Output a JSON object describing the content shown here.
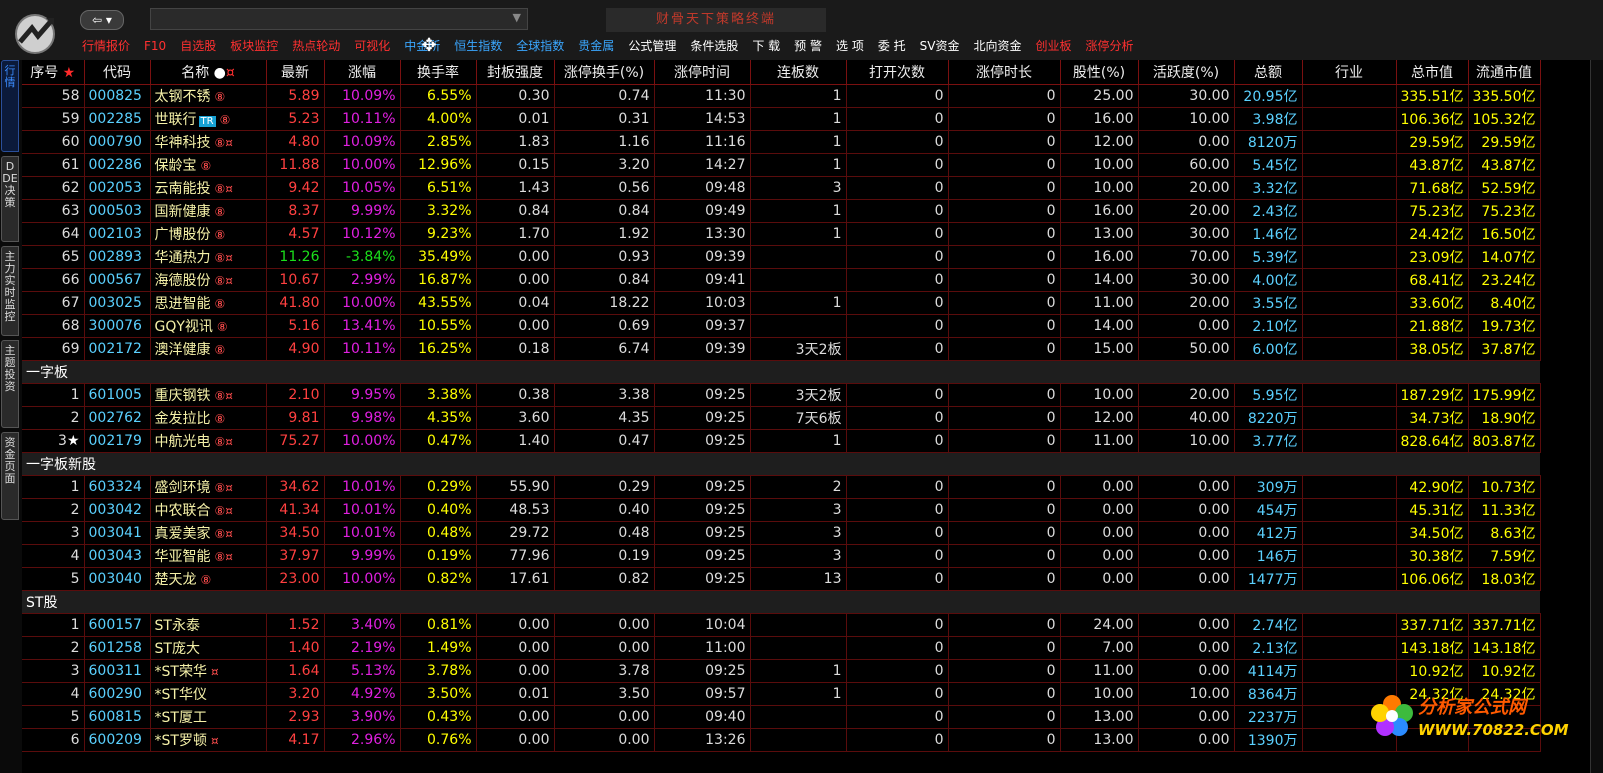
{
  "topbar": {
    "app_title": "财骨天下策略终端",
    "menu": [
      {
        "label": "行情报价",
        "color": "#ff3030"
      },
      {
        "label": "F10",
        "color": "#ff3030"
      },
      {
        "label": "自选股",
        "color": "#ff3030"
      },
      {
        "label": "板块监控",
        "color": "#ff3030"
      },
      {
        "label": "热点轮动",
        "color": "#ff3030"
      },
      {
        "label": "可视化",
        "color": "#ff3030"
      },
      {
        "label": "中金所",
        "color": "#3aa7ff"
      },
      {
        "label": "恒生指数",
        "color": "#3aa7ff"
      },
      {
        "label": "全球指数",
        "color": "#3aa7ff"
      },
      {
        "label": "贵金属",
        "color": "#3aa7ff"
      },
      {
        "label": "公式管理",
        "color": "#ffffff"
      },
      {
        "label": "条件选股",
        "color": "#ffffff"
      },
      {
        "label": "下  载",
        "color": "#ffffff"
      },
      {
        "label": "预  警",
        "color": "#ffffff"
      },
      {
        "label": "选  项",
        "color": "#ffffff"
      },
      {
        "label": "委  托",
        "color": "#ffffff"
      },
      {
        "label": "SV资金",
        "color": "#ffffff"
      },
      {
        "label": "北向资金",
        "color": "#ffffff"
      },
      {
        "label": "创业板",
        "color": "#ff3030"
      },
      {
        "label": "涨停分析",
        "color": "#ff3030"
      }
    ]
  },
  "left_tabs": [
    "行情",
    "DDE决策",
    "主力实时监控",
    "主题投资",
    "资金页面"
  ],
  "table": {
    "headers": [
      "序号",
      "代码",
      "名称",
      "最新",
      "涨幅",
      "换手率",
      "封板强度",
      "涨停换手(%)",
      "涨停时间",
      "连板数",
      "打开次数",
      "涨停时长",
      "股性(%)",
      "活跃度(%)",
      "总额",
      "行业",
      "总市值",
      "流通市值"
    ],
    "rows": [
      {
        "type": "data",
        "idx": "58",
        "code": "000825",
        "name": "太钢不锈",
        "marks": "⑧",
        "price": "5.89",
        "chg": "10.09%",
        "turn": "6.55%",
        "seal": "0.30",
        "ztturn": "0.74",
        "zttime": "11:30",
        "lianban": "1",
        "opens": "0",
        "ztlen": "0",
        "gx": "25.00",
        "active": "30.00",
        "amt": "20.95亿",
        "ind": "",
        "cap": "335.51亿",
        "fcap": "335.50亿"
      },
      {
        "type": "data",
        "idx": "59",
        "code": "002285",
        "name": "世联行",
        "tr": "TR",
        "marks": "⑧",
        "price": "5.23",
        "chg": "10.11%",
        "turn": "4.00%",
        "seal": "0.01",
        "ztturn": "0.31",
        "zttime": "14:53",
        "lianban": "1",
        "opens": "0",
        "ztlen": "0",
        "gx": "16.00",
        "active": "10.00",
        "amt": "3.98亿",
        "ind": "",
        "cap": "106.36亿",
        "fcap": "105.32亿"
      },
      {
        "type": "data",
        "idx": "60",
        "code": "000790",
        "name": "华神科技",
        "marks": "⑧¤",
        "price": "4.80",
        "chg": "10.09%",
        "turn": "2.85%",
        "seal": "1.83",
        "ztturn": "1.16",
        "zttime": "11:16",
        "lianban": "1",
        "opens": "0",
        "ztlen": "0",
        "gx": "12.00",
        "active": "0.00",
        "amt": "8120万",
        "ind": "",
        "cap": "29.59亿",
        "fcap": "29.59亿"
      },
      {
        "type": "data",
        "idx": "61",
        "code": "002286",
        "name": "保龄宝",
        "marks": "⑧",
        "price": "11.88",
        "chg": "10.00%",
        "turn": "12.96%",
        "seal": "0.15",
        "ztturn": "3.20",
        "zttime": "14:27",
        "lianban": "1",
        "opens": "0",
        "ztlen": "0",
        "gx": "10.00",
        "active": "60.00",
        "amt": "5.45亿",
        "ind": "",
        "cap": "43.87亿",
        "fcap": "43.87亿"
      },
      {
        "type": "data",
        "idx": "62",
        "code": "002053",
        "name": "云南能投",
        "marks": "⑧¤",
        "price": "9.42",
        "chg": "10.05%",
        "turn": "6.51%",
        "seal": "1.43",
        "ztturn": "0.56",
        "zttime": "09:48",
        "lianban": "3",
        "opens": "0",
        "ztlen": "0",
        "gx": "10.00",
        "active": "20.00",
        "amt": "3.32亿",
        "ind": "",
        "cap": "71.68亿",
        "fcap": "52.59亿"
      },
      {
        "type": "data",
        "idx": "63",
        "code": "000503",
        "name": "国新健康",
        "marks": "⑧",
        "price": "8.37",
        "chg": "9.99%",
        "turn": "3.32%",
        "seal": "0.84",
        "ztturn": "0.84",
        "zttime": "09:49",
        "lianban": "1",
        "opens": "0",
        "ztlen": "0",
        "gx": "16.00",
        "active": "20.00",
        "amt": "2.43亿",
        "ind": "",
        "cap": "75.23亿",
        "fcap": "75.23亿"
      },
      {
        "type": "data",
        "idx": "64",
        "code": "002103",
        "name": "广博股份",
        "marks": "⑧",
        "price": "4.57",
        "chg": "10.12%",
        "turn": "9.23%",
        "seal": "1.70",
        "ztturn": "1.92",
        "zttime": "13:30",
        "lianban": "1",
        "opens": "0",
        "ztlen": "0",
        "gx": "13.00",
        "active": "30.00",
        "amt": "1.46亿",
        "ind": "",
        "cap": "24.42亿",
        "fcap": "16.50亿"
      },
      {
        "type": "data",
        "idx": "65",
        "code": "002893",
        "name": "华通热力",
        "marks": "⑧¤",
        "price": "11.26",
        "chg": "-3.84%",
        "neg": true,
        "turn": "35.49%",
        "seal": "0.00",
        "ztturn": "0.93",
        "zttime": "09:39",
        "lianban": "",
        "opens": "0",
        "ztlen": "0",
        "gx": "16.00",
        "active": "70.00",
        "amt": "5.39亿",
        "ind": "",
        "cap": "23.09亿",
        "fcap": "14.07亿"
      },
      {
        "type": "data",
        "idx": "66",
        "code": "000567",
        "name": "海德股份",
        "marks": "⑧¤",
        "price": "10.67",
        "chg": "2.99%",
        "turn": "16.87%",
        "seal": "0.00",
        "ztturn": "0.84",
        "zttime": "09:41",
        "lianban": "",
        "opens": "0",
        "ztlen": "0",
        "gx": "14.00",
        "active": "30.00",
        "amt": "4.00亿",
        "ind": "",
        "cap": "68.41亿",
        "fcap": "23.24亿"
      },
      {
        "type": "data",
        "idx": "67",
        "code": "003025",
        "name": "思进智能",
        "marks": "⑧",
        "price": "41.80",
        "chg": "10.00%",
        "turn": "43.55%",
        "seal": "0.04",
        "ztturn": "18.22",
        "zttime": "10:03",
        "lianban": "1",
        "opens": "0",
        "ztlen": "0",
        "gx": "11.00",
        "active": "20.00",
        "amt": "3.55亿",
        "ind": "",
        "cap": "33.60亿",
        "fcap": "8.40亿"
      },
      {
        "type": "data",
        "idx": "68",
        "code": "300076",
        "name": "GQY视讯",
        "marks": "⑧",
        "price": "5.16",
        "chg": "13.41%",
        "turn": "10.55%",
        "seal": "0.00",
        "ztturn": "0.69",
        "zttime": "09:37",
        "lianban": "",
        "opens": "0",
        "ztlen": "0",
        "gx": "14.00",
        "active": "0.00",
        "amt": "2.10亿",
        "ind": "",
        "cap": "21.88亿",
        "fcap": "19.73亿"
      },
      {
        "type": "data",
        "idx": "69",
        "code": "002172",
        "name": "澳洋健康",
        "marks": "⑧",
        "price": "4.90",
        "chg": "10.11%",
        "turn": "16.25%",
        "seal": "0.18",
        "ztturn": "6.74",
        "zttime": "09:39",
        "lianban": "3天2板",
        "opens": "0",
        "ztlen": "0",
        "gx": "15.00",
        "active": "50.00",
        "amt": "6.00亿",
        "ind": "",
        "cap": "38.05亿",
        "fcap": "37.87亿"
      },
      {
        "type": "sec",
        "label": "一字板"
      },
      {
        "type": "data",
        "idx": "1",
        "code": "601005",
        "name": "重庆钢铁",
        "marks": "⑧¤",
        "price": "2.10",
        "chg": "9.95%",
        "turn": "3.38%",
        "seal": "0.38",
        "ztturn": "3.38",
        "zttime": "09:25",
        "lianban": "3天2板",
        "opens": "0",
        "ztlen": "0",
        "gx": "10.00",
        "active": "20.00",
        "amt": "5.95亿",
        "ind": "",
        "cap": "187.29亿",
        "fcap": "175.99亿"
      },
      {
        "type": "data",
        "idx": "2",
        "code": "002762",
        "name": "金发拉比",
        "marks": "⑧",
        "price": "9.81",
        "chg": "9.98%",
        "turn": "4.35%",
        "seal": "3.60",
        "ztturn": "4.35",
        "zttime": "09:25",
        "lianban": "7天6板",
        "opens": "0",
        "ztlen": "0",
        "gx": "12.00",
        "active": "40.00",
        "amt": "8220万",
        "ind": "",
        "cap": "34.73亿",
        "fcap": "18.90亿"
      },
      {
        "type": "data",
        "idx": "3",
        "star": "★",
        "code": "002179",
        "name": "中航光电",
        "marks": "⑧¤",
        "price": "75.27",
        "chg": "10.00%",
        "turn": "0.47%",
        "seal": "1.40",
        "ztturn": "0.47",
        "zttime": "09:25",
        "lianban": "1",
        "opens": "0",
        "ztlen": "0",
        "gx": "11.00",
        "active": "10.00",
        "amt": "3.77亿",
        "ind": "",
        "cap": "828.64亿",
        "fcap": "803.87亿"
      },
      {
        "type": "sec",
        "label": "一字板新股"
      },
      {
        "type": "data",
        "idx": "1",
        "code": "603324",
        "name": "盛剑环境",
        "marks": "⑧¤",
        "price": "34.62",
        "chg": "10.01%",
        "turn": "0.29%",
        "seal": "55.90",
        "ztturn": "0.29",
        "zttime": "09:25",
        "lianban": "2",
        "opens": "0",
        "ztlen": "0",
        "gx": "0.00",
        "active": "0.00",
        "amt": "309万",
        "ind": "",
        "cap": "42.90亿",
        "fcap": "10.73亿"
      },
      {
        "type": "data",
        "idx": "2",
        "code": "003042",
        "name": "中农联合",
        "marks": "⑧¤",
        "price": "41.34",
        "chg": "10.01%",
        "turn": "0.40%",
        "seal": "48.53",
        "ztturn": "0.40",
        "zttime": "09:25",
        "lianban": "3",
        "opens": "0",
        "ztlen": "0",
        "gx": "0.00",
        "active": "0.00",
        "amt": "454万",
        "ind": "",
        "cap": "45.31亿",
        "fcap": "11.33亿"
      },
      {
        "type": "data",
        "idx": "3",
        "code": "003041",
        "name": "真爱美家",
        "marks": "⑧¤",
        "price": "34.50",
        "chg": "10.01%",
        "turn": "0.48%",
        "seal": "29.72",
        "ztturn": "0.48",
        "zttime": "09:25",
        "lianban": "3",
        "opens": "0",
        "ztlen": "0",
        "gx": "0.00",
        "active": "0.00",
        "amt": "412万",
        "ind": "",
        "cap": "34.50亿",
        "fcap": "8.63亿"
      },
      {
        "type": "data",
        "idx": "4",
        "code": "003043",
        "name": "华亚智能",
        "marks": "⑧¤",
        "price": "37.97",
        "chg": "9.99%",
        "turn": "0.19%",
        "seal": "77.96",
        "ztturn": "0.19",
        "zttime": "09:25",
        "lianban": "3",
        "opens": "0",
        "ztlen": "0",
        "gx": "0.00",
        "active": "0.00",
        "amt": "146万",
        "ind": "",
        "cap": "30.38亿",
        "fcap": "7.59亿"
      },
      {
        "type": "data",
        "idx": "5",
        "code": "003040",
        "name": "楚天龙",
        "marks": "⑧",
        "price": "23.00",
        "chg": "10.00%",
        "turn": "0.82%",
        "seal": "17.61",
        "ztturn": "0.82",
        "zttime": "09:25",
        "lianban": "13",
        "opens": "0",
        "ztlen": "0",
        "gx": "0.00",
        "active": "0.00",
        "amt": "1477万",
        "ind": "",
        "cap": "106.06亿",
        "fcap": "18.03亿"
      },
      {
        "type": "sec",
        "label": "ST股"
      },
      {
        "type": "data",
        "idx": "1",
        "code": "600157",
        "name": "ST永泰",
        "marks": "",
        "price": "1.52",
        "chg": "3.40%",
        "turn": "0.81%",
        "seal": "0.00",
        "ztturn": "0.00",
        "zttime": "10:04",
        "lianban": "",
        "opens": "0",
        "ztlen": "0",
        "gx": "24.00",
        "active": "0.00",
        "amt": "2.74亿",
        "ind": "",
        "cap": "337.71亿",
        "fcap": "337.71亿"
      },
      {
        "type": "data",
        "idx": "2",
        "code": "601258",
        "name": "ST庞大",
        "marks": "",
        "price": "1.40",
        "chg": "2.19%",
        "turn": "1.49%",
        "seal": "0.00",
        "ztturn": "0.00",
        "zttime": "11:00",
        "lianban": "",
        "opens": "0",
        "ztlen": "0",
        "gx": "7.00",
        "active": "0.00",
        "amt": "2.13亿",
        "ind": "",
        "cap": "143.18亿",
        "fcap": "143.18亿"
      },
      {
        "type": "data",
        "idx": "3",
        "code": "600311",
        "name": "*ST荣华",
        "marks": "¤",
        "price": "1.64",
        "chg": "5.13%",
        "turn": "3.78%",
        "seal": "0.00",
        "ztturn": "3.78",
        "zttime": "09:25",
        "lianban": "1",
        "opens": "0",
        "ztlen": "0",
        "gx": "11.00",
        "active": "0.00",
        "amt": "4114万",
        "ind": "",
        "cap": "10.92亿",
        "fcap": "10.92亿"
      },
      {
        "type": "data",
        "idx": "4",
        "code": "600290",
        "name": "*ST华仪",
        "marks": "",
        "price": "3.20",
        "chg": "4.92%",
        "turn": "3.50%",
        "seal": "0.01",
        "ztturn": "3.50",
        "zttime": "09:57",
        "lianban": "1",
        "opens": "0",
        "ztlen": "0",
        "gx": "10.00",
        "active": "10.00",
        "amt": "8364万",
        "ind": "",
        "cap": "24.32亿",
        "fcap": "24.32亿"
      },
      {
        "type": "data",
        "idx": "5",
        "code": "600815",
        "name": "*ST厦工",
        "marks": "",
        "price": "2.93",
        "chg": "3.90%",
        "turn": "0.43%",
        "seal": "0.00",
        "ztturn": "0.00",
        "zttime": "09:40",
        "lianban": "",
        "opens": "0",
        "ztlen": "0",
        "gx": "13.00",
        "active": "0.00",
        "amt": "2237万",
        "ind": "",
        "cap": "",
        "fcap": ""
      },
      {
        "type": "data",
        "idx": "6",
        "code": "600209",
        "name": "*ST罗顿",
        "marks": "¤",
        "price": "4.17",
        "chg": "2.96%",
        "turn": "0.76%",
        "seal": "0.00",
        "ztturn": "0.00",
        "zttime": "13:26",
        "lianban": "",
        "opens": "0",
        "ztlen": "0",
        "gx": "13.00",
        "active": "0.00",
        "amt": "1390万",
        "ind": "",
        "cap": "",
        "fcap": ""
      }
    ]
  },
  "watermark": {
    "name": "分析家公式网",
    "url": "WWW.70822.COM"
  }
}
